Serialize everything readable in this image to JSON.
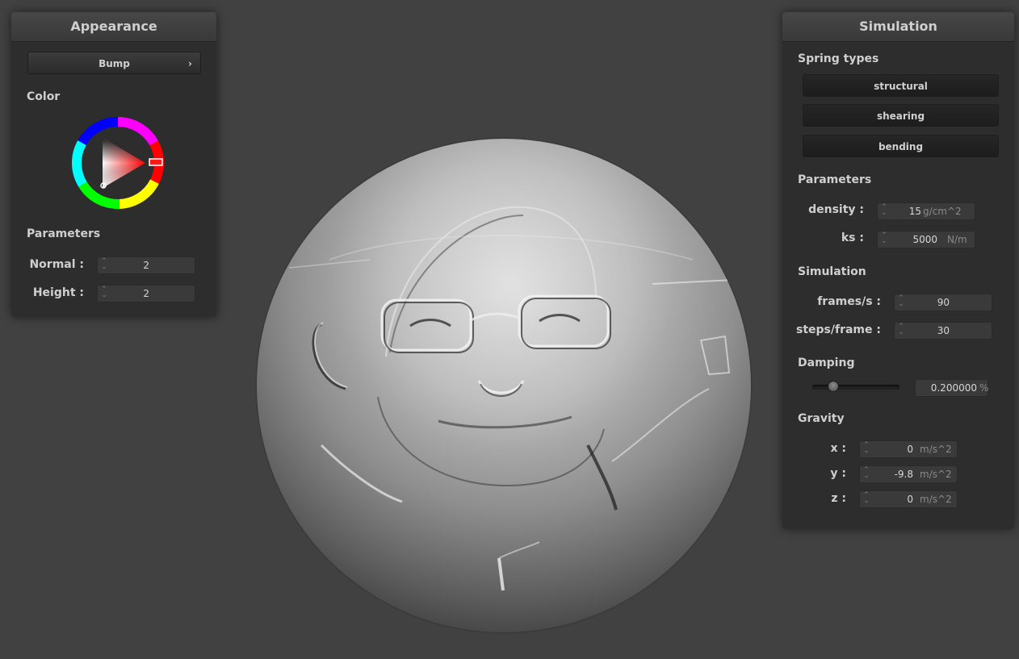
{
  "appearance": {
    "title": "Appearance",
    "shader_dropdown": "Bump",
    "color_label": "Color",
    "params_label": "Parameters",
    "normal": {
      "label": "Normal :",
      "value": "2"
    },
    "height": {
      "label": "Height :",
      "value": "2"
    },
    "selected_color": "#ff0000"
  },
  "simulation": {
    "title": "Simulation",
    "spring_types_label": "Spring types",
    "spring_buttons": [
      "structural",
      "shearing",
      "bending"
    ],
    "params_label": "Parameters",
    "density": {
      "label": "density :",
      "value": "15",
      "unit": "g/cm^2"
    },
    "ks": {
      "label": "ks :",
      "value": "5000",
      "unit": "N/m"
    },
    "sim_label": "Simulation",
    "fps": {
      "label": "frames/s :",
      "value": "90"
    },
    "steps": {
      "label": "steps/frame :",
      "value": "30"
    },
    "damping_label": "Damping",
    "damping": {
      "value": "0.200000",
      "unit": "%",
      "slider_fraction": 0.2
    },
    "gravity_label": "Gravity",
    "gx": {
      "label": "x :",
      "value": "0",
      "unit": "m/s^2"
    },
    "gy": {
      "label": "y :",
      "value": "-9.8",
      "unit": "m/s^2"
    },
    "gz": {
      "label": "z :",
      "value": "0",
      "unit": "m/s^2"
    }
  }
}
